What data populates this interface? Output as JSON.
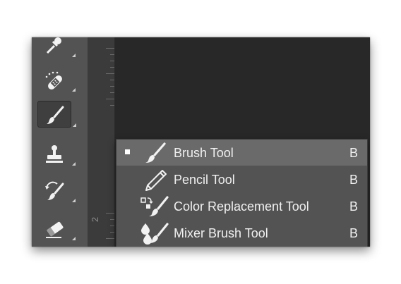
{
  "toolbar": {
    "tools": [
      {
        "name": "eyedropper-tool"
      },
      {
        "name": "spot-healing-brush-tool"
      },
      {
        "name": "brush-tool",
        "active": true
      },
      {
        "name": "clone-stamp-tool"
      },
      {
        "name": "history-brush-tool"
      },
      {
        "name": "eraser-tool"
      }
    ]
  },
  "ruler": {
    "label": "2"
  },
  "flyout": {
    "items": [
      {
        "label": "Brush Tool",
        "shortcut": "B",
        "icon": "brush-icon",
        "selected": true
      },
      {
        "label": "Pencil Tool",
        "shortcut": "B",
        "icon": "pencil-icon"
      },
      {
        "label": "Color Replacement Tool",
        "shortcut": "B",
        "icon": "color-replacement-icon"
      },
      {
        "label": "Mixer Brush Tool",
        "shortcut": "B",
        "icon": "mixer-brush-icon"
      }
    ]
  },
  "colors": {
    "panel": "#535353",
    "canvas": "#282828",
    "selected_item": "#6a6a6a",
    "text": "#f0f0f0"
  }
}
